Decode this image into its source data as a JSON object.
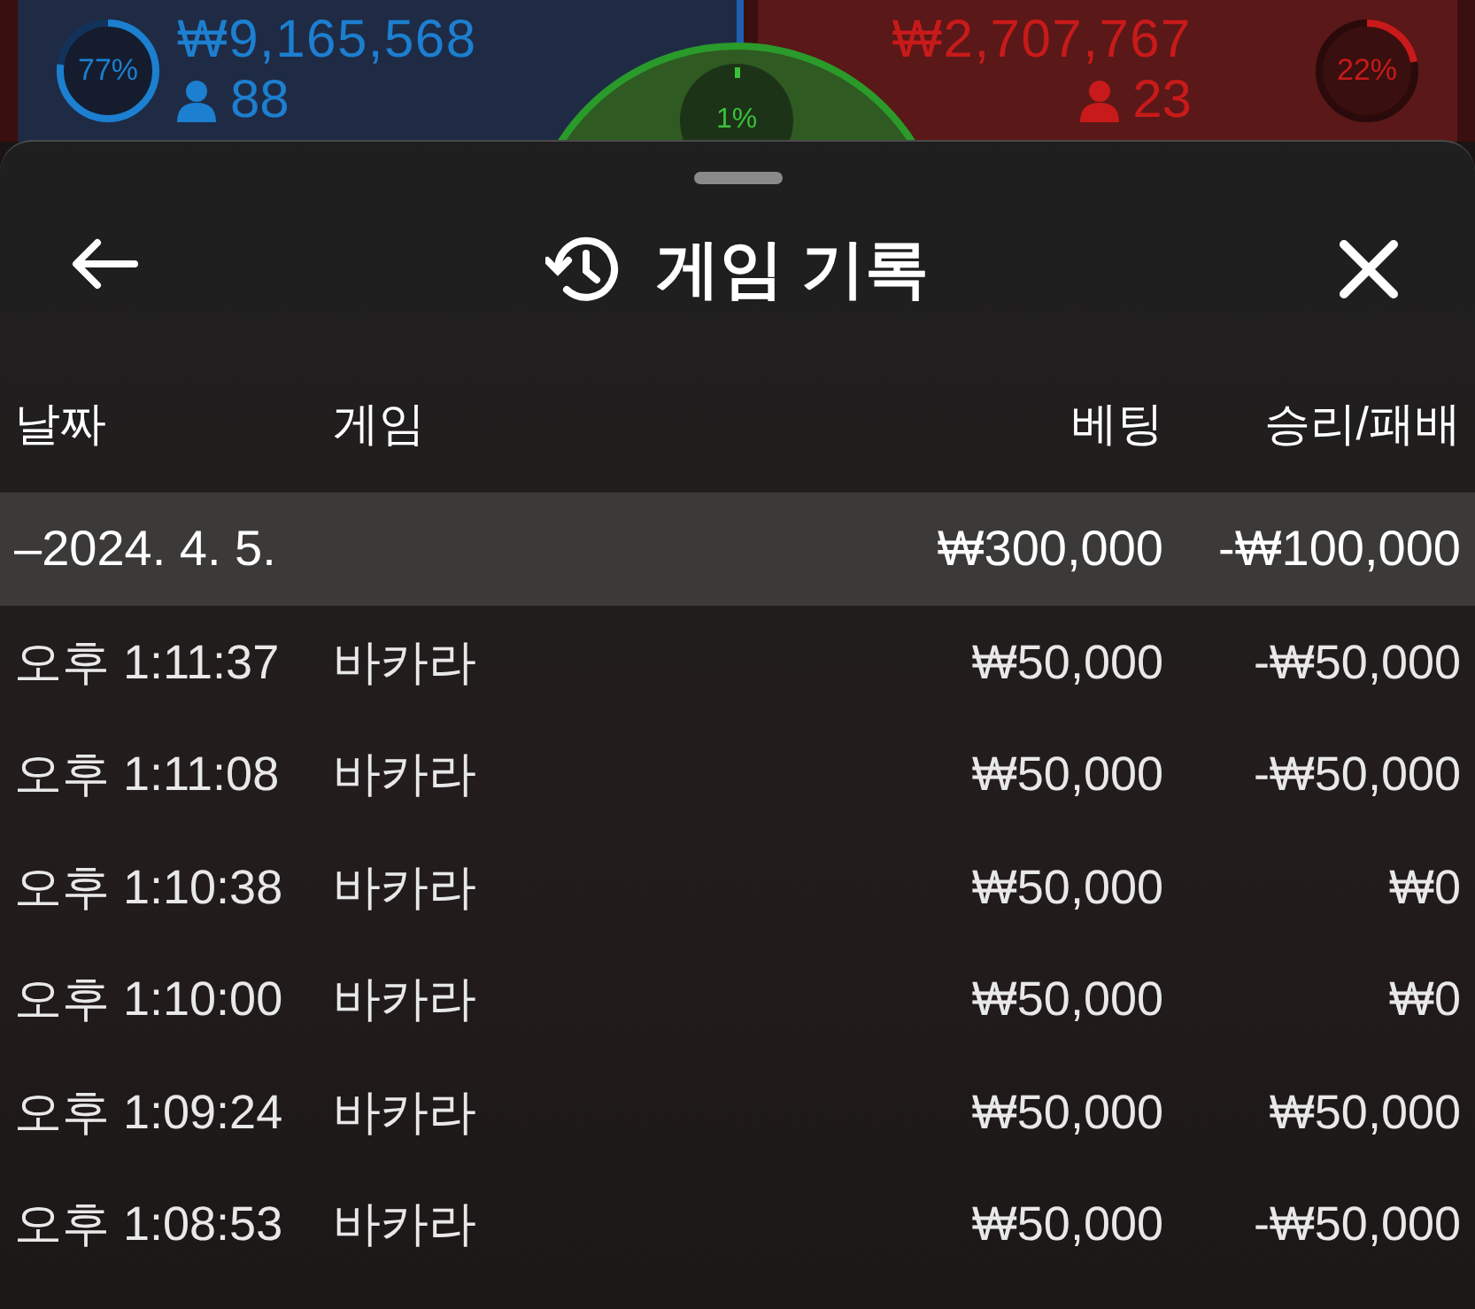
{
  "scoreboard": {
    "player": {
      "percent": "77%",
      "amount": "₩9,165,568",
      "count": "88"
    },
    "tie": {
      "percent": "1%"
    },
    "banker": {
      "percent": "22%",
      "amount": "₩2,707,767",
      "count": "23"
    }
  },
  "sheet": {
    "title": "게임 기록",
    "columns": [
      "날짜",
      "게임",
      "베팅",
      "승리/패배"
    ],
    "group": {
      "label": "–2024. 4. 5.",
      "bet": "₩300,000",
      "result": "-₩100,000"
    },
    "rows": [
      {
        "time": "오후 1:11:37",
        "game": "바카라",
        "bet": "₩50,000",
        "result": "-₩50,000"
      },
      {
        "time": "오후 1:11:08",
        "game": "바카라",
        "bet": "₩50,000",
        "result": "-₩50,000"
      },
      {
        "time": "오후 1:10:38",
        "game": "바카라",
        "bet": "₩50,000",
        "result": "₩0"
      },
      {
        "time": "오후 1:10:00",
        "game": "바카라",
        "bet": "₩50,000",
        "result": "₩0"
      },
      {
        "time": "오후 1:09:24",
        "game": "바카라",
        "bet": "₩50,000",
        "result": "₩50,000"
      },
      {
        "time": "오후 1:08:53",
        "game": "바카라",
        "bet": "₩50,000",
        "result": "-₩50,000"
      }
    ]
  }
}
